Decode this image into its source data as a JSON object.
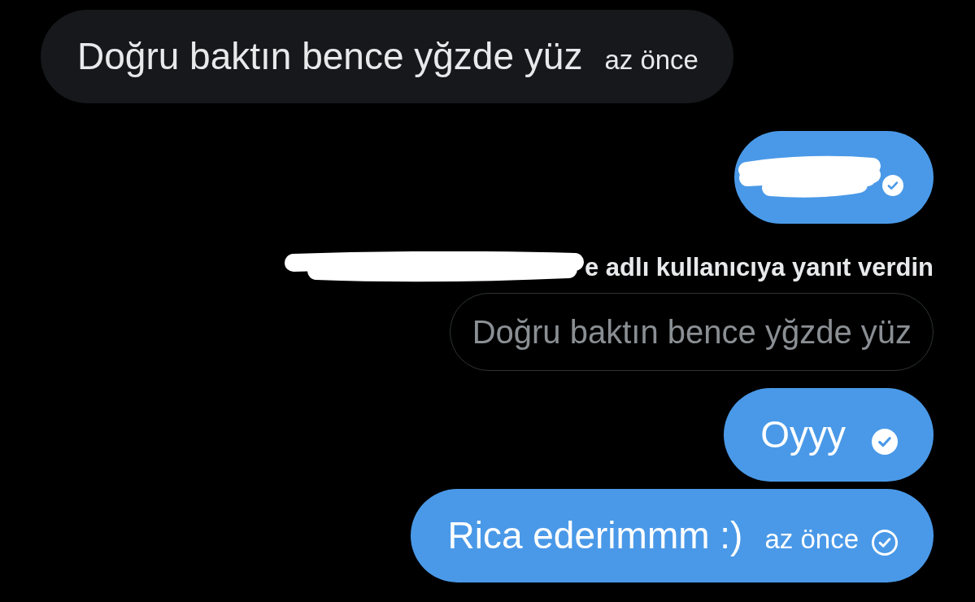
{
  "messages": [
    {
      "kind": "incoming",
      "text": "Doğru baktın bence yğzde yüz",
      "time": "az önce"
    },
    {
      "kind": "outgoing",
      "redacted": true,
      "read": true
    },
    {
      "kind": "reply_note",
      "redacted": true,
      "text": "e adlı kullanıcıya yanıt verdin"
    },
    {
      "kind": "quoted",
      "text": "Doğru baktın bence yğzde yüz"
    },
    {
      "kind": "outgoing",
      "text": "Oyyy",
      "read": true
    },
    {
      "kind": "outgoing",
      "text": "Rica ederimmm :)",
      "time": "az önce",
      "read": false
    }
  ]
}
